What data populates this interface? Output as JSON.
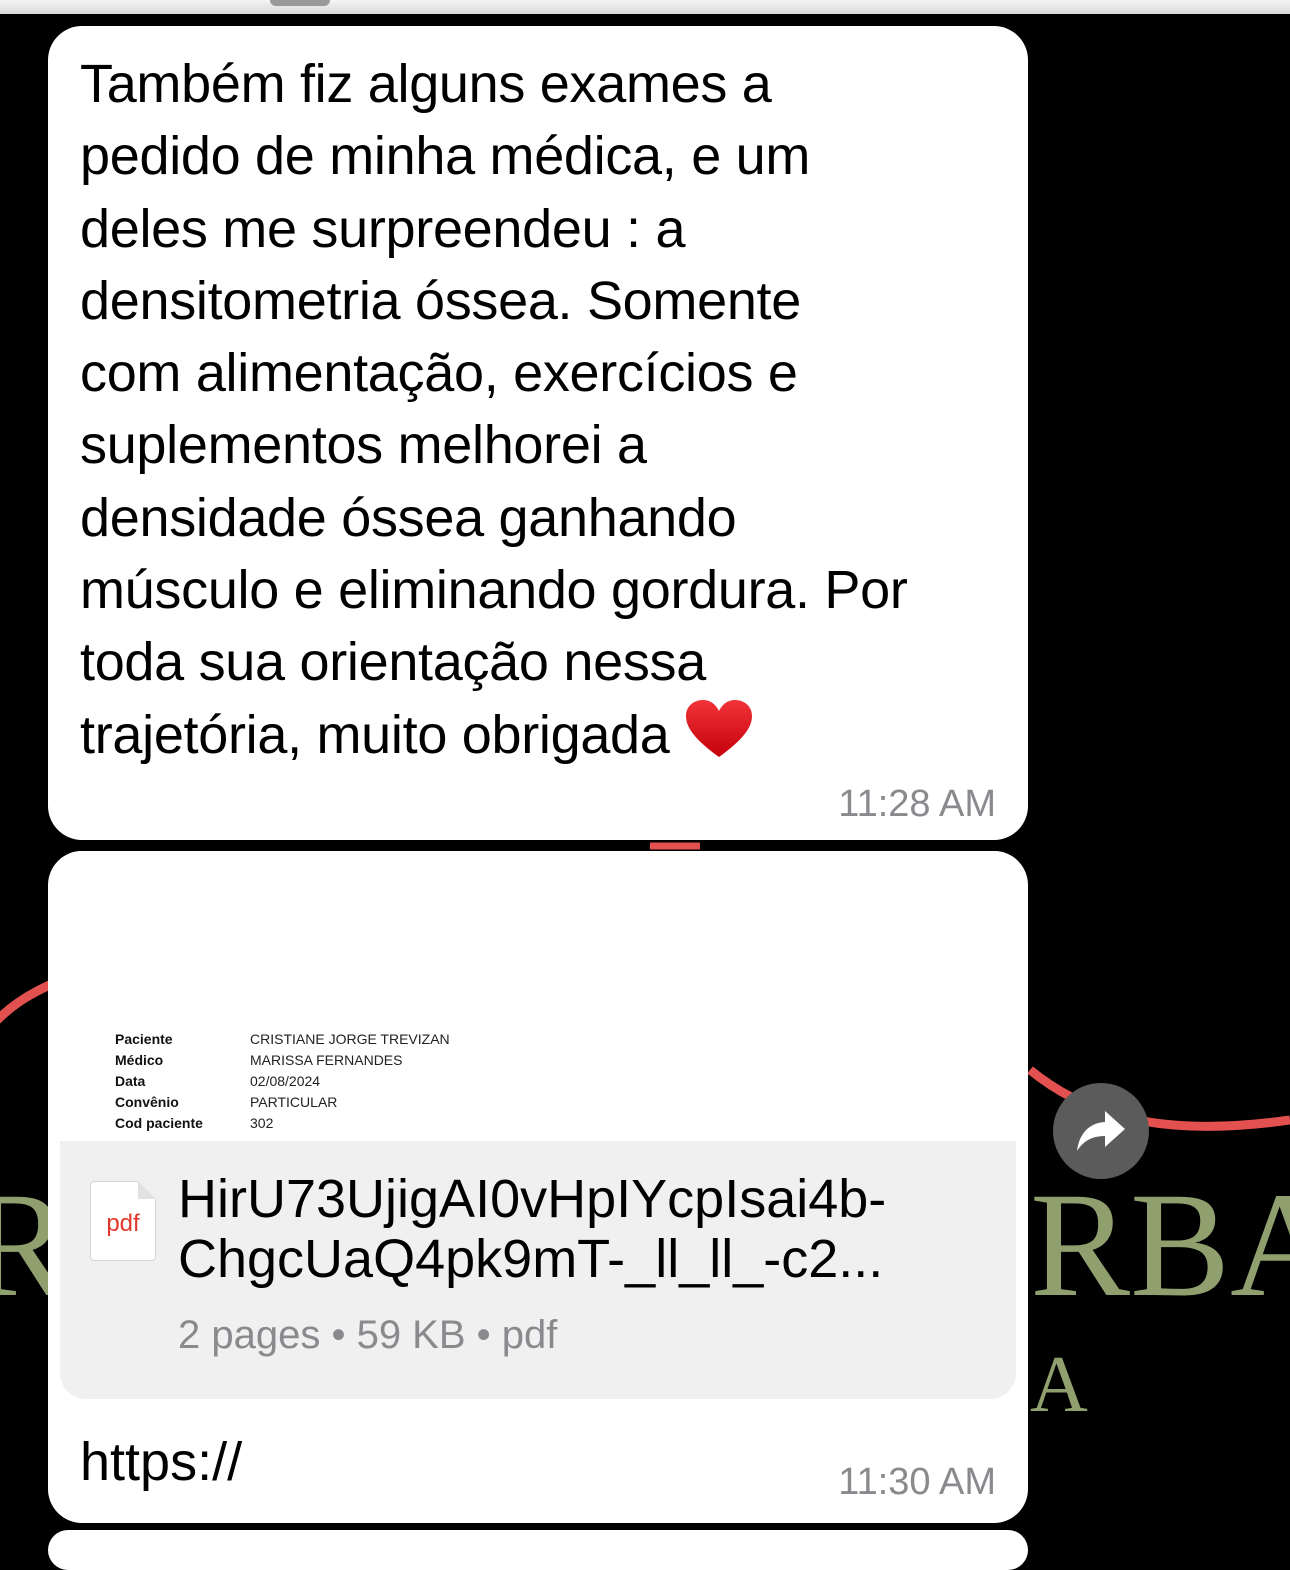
{
  "message_1": {
    "text": "Também fiz alguns exames a\npedido de minha médica, e um\ndeles me surpreendeu : a\ndensitometria óssea. Somente\ncom alimentação, exercícios e\nsuplementos melhorei a\ndensidade óssea  ganhando\nmúsculo e eliminando gordura. Por\ntoda sua orientação nessa\ntrajetória, muito obrigada ",
    "emoji": "heart-icon",
    "time": "11:28 AM"
  },
  "message_2": {
    "preview": {
      "rows": [
        {
          "key": "Paciente",
          "value": "CRISTIANE JORGE TREVIZAN"
        },
        {
          "key": "Médico",
          "value": "MARISSA FERNANDES"
        },
        {
          "key": "Data",
          "value": "02/08/2024"
        },
        {
          "key": "Convênio",
          "value": "PARTICULAR"
        },
        {
          "key": "Cod paciente",
          "value": "302"
        }
      ]
    },
    "file": {
      "icon_label": "pdf",
      "name_line_1": "HirU73UjigAI0vHpIYcpIsai4b-",
      "name_line_2": "ChgcUaQ4pk9mT-_ll_ll_-c2...",
      "meta": "2 pages • 59 KB • pdf"
    },
    "link_text": "https://",
    "time": "11:30 AM"
  },
  "background": {
    "left_letters": "R",
    "right_letters": "RBA",
    "sub_letters": "A"
  },
  "colors": {
    "background": "#000000",
    "bubble": "#ffffff",
    "timestamp": "#8a8a8e",
    "wallpaper_text": "#8fa06e",
    "wallpaper_stroke": "#e2514f"
  }
}
